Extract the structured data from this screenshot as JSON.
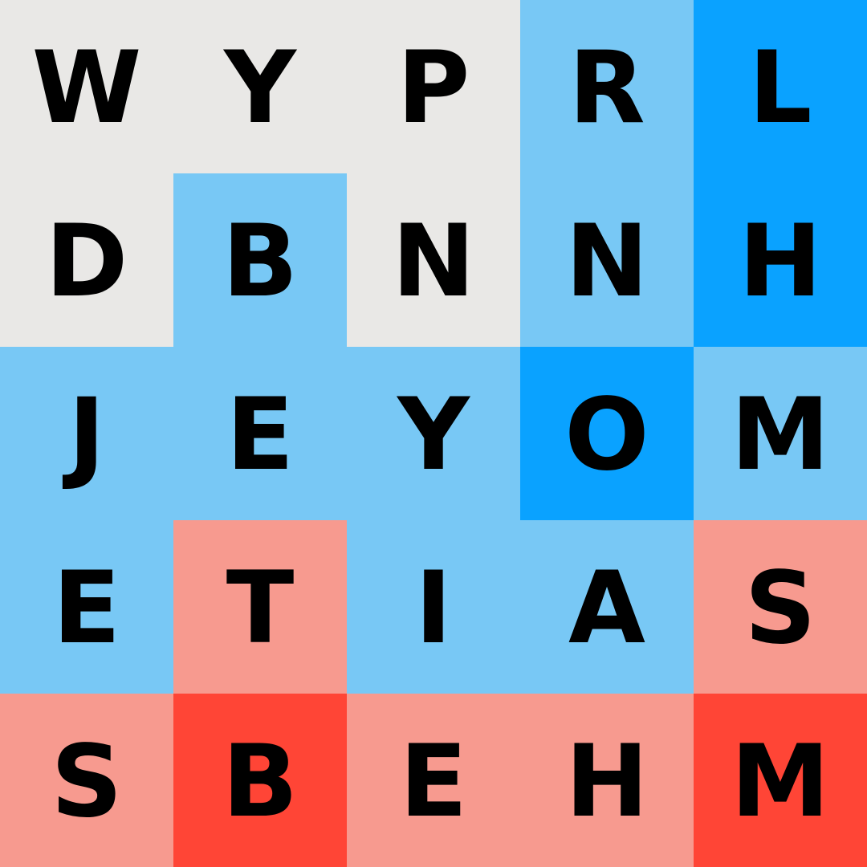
{
  "board": {
    "rows": [
      [
        {
          "letter": "W",
          "owner": "neutral"
        },
        {
          "letter": "Y",
          "owner": "neutral"
        },
        {
          "letter": "P",
          "owner": "neutral"
        },
        {
          "letter": "R",
          "owner": "blue"
        },
        {
          "letter": "L",
          "owner": "blue-dark"
        }
      ],
      [
        {
          "letter": "D",
          "owner": "neutral"
        },
        {
          "letter": "B",
          "owner": "blue"
        },
        {
          "letter": "N",
          "owner": "neutral"
        },
        {
          "letter": "N",
          "owner": "blue"
        },
        {
          "letter": "H",
          "owner": "blue-dark"
        }
      ],
      [
        {
          "letter": "J",
          "owner": "blue"
        },
        {
          "letter": "E",
          "owner": "blue"
        },
        {
          "letter": "Y",
          "owner": "blue"
        },
        {
          "letter": "O",
          "owner": "blue-dark"
        },
        {
          "letter": "M",
          "owner": "blue"
        }
      ],
      [
        {
          "letter": "E",
          "owner": "blue"
        },
        {
          "letter": "T",
          "owner": "red"
        },
        {
          "letter": "I",
          "owner": "blue"
        },
        {
          "letter": "A",
          "owner": "blue"
        },
        {
          "letter": "S",
          "owner": "red"
        }
      ],
      [
        {
          "letter": "S",
          "owner": "red"
        },
        {
          "letter": "B",
          "owner": "red-dark"
        },
        {
          "letter": "E",
          "owner": "red"
        },
        {
          "letter": "H",
          "owner": "red"
        },
        {
          "letter": "M",
          "owner": "red-dark"
        }
      ]
    ]
  },
  "colors": {
    "neutral": "#e9e8e6",
    "blue": "#78c8f5",
    "blue-dark": "#0aa2ff",
    "red": "#f79a8f",
    "red-dark": "#ff4536",
    "letter": "#000000"
  }
}
